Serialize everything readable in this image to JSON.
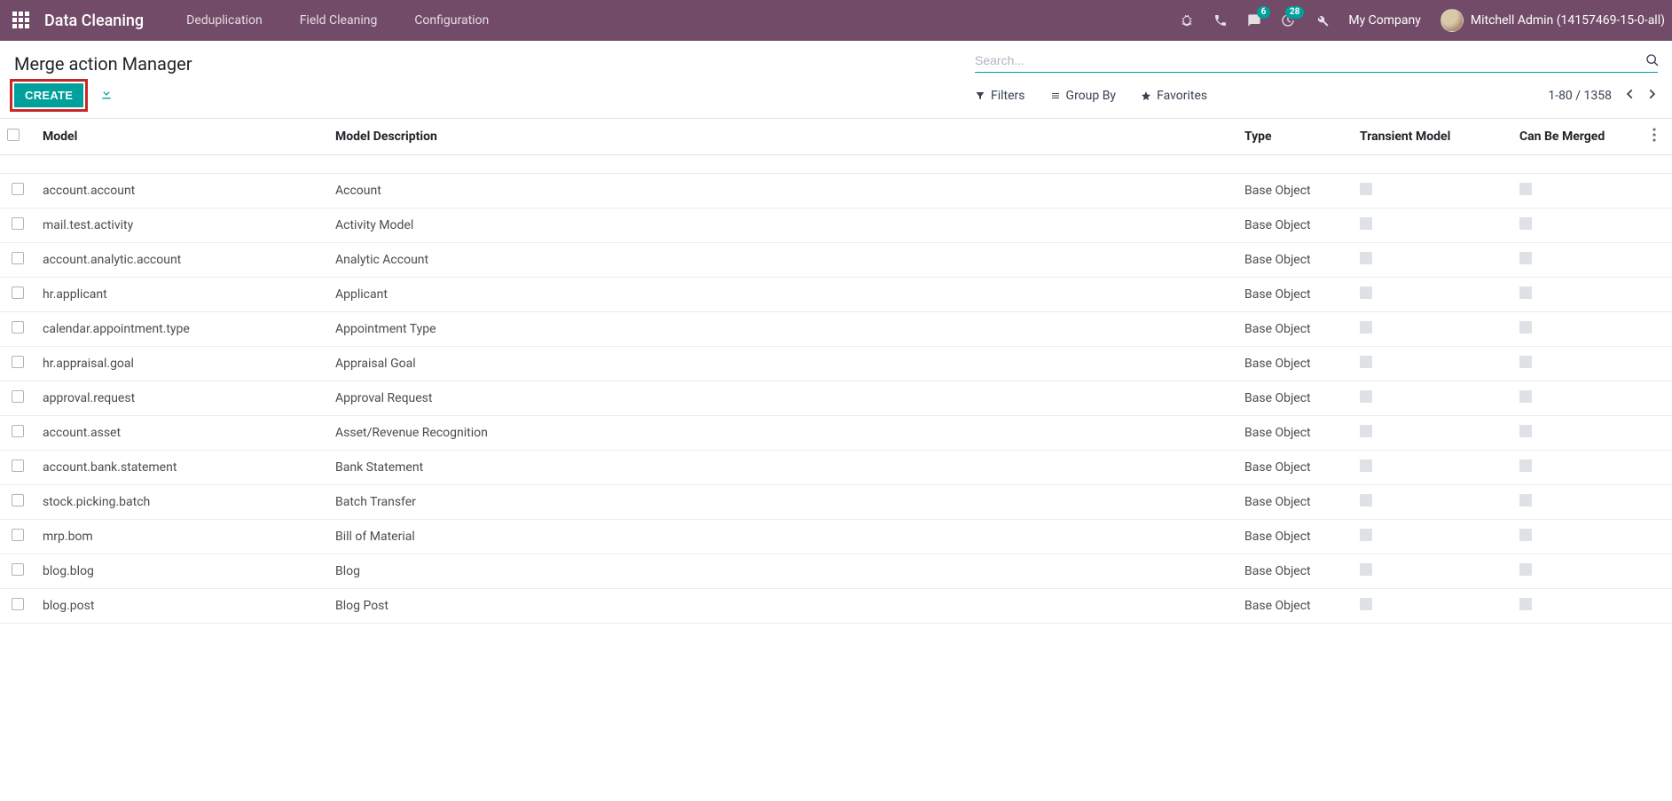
{
  "navbar": {
    "app_title": "Data Cleaning",
    "menu": [
      "Deduplication",
      "Field Cleaning",
      "Configuration"
    ],
    "badges": {
      "messages": "6",
      "activities": "28"
    },
    "company": "My Company",
    "user": "Mitchell Admin (14157469-15-0-all)"
  },
  "page": {
    "title": "Merge action Manager",
    "search_placeholder": "Search...",
    "create_label": "CREATE",
    "tools": {
      "filters": "Filters",
      "group_by": "Group By",
      "favorites": "Favorites"
    },
    "pager": "1-80 / 1358"
  },
  "table": {
    "headers": {
      "model": "Model",
      "description": "Model Description",
      "type": "Type",
      "transient": "Transient Model",
      "can_merge": "Can Be Merged"
    },
    "rows": [
      {
        "model": "account.account",
        "description": "Account",
        "type": "Base Object"
      },
      {
        "model": "mail.test.activity",
        "description": "Activity Model",
        "type": "Base Object"
      },
      {
        "model": "account.analytic.account",
        "description": "Analytic Account",
        "type": "Base Object"
      },
      {
        "model": "hr.applicant",
        "description": "Applicant",
        "type": "Base Object"
      },
      {
        "model": "calendar.appointment.type",
        "description": "Appointment Type",
        "type": "Base Object"
      },
      {
        "model": "hr.appraisal.goal",
        "description": "Appraisal Goal",
        "type": "Base Object"
      },
      {
        "model": "approval.request",
        "description": "Approval Request",
        "type": "Base Object"
      },
      {
        "model": "account.asset",
        "description": "Asset/Revenue Recognition",
        "type": "Base Object"
      },
      {
        "model": "account.bank.statement",
        "description": "Bank Statement",
        "type": "Base Object"
      },
      {
        "model": "stock.picking.batch",
        "description": "Batch Transfer",
        "type": "Base Object"
      },
      {
        "model": "mrp.bom",
        "description": "Bill of Material",
        "type": "Base Object"
      },
      {
        "model": "blog.blog",
        "description": "Blog",
        "type": "Base Object"
      },
      {
        "model": "blog.post",
        "description": "Blog Post",
        "type": "Base Object"
      }
    ]
  }
}
